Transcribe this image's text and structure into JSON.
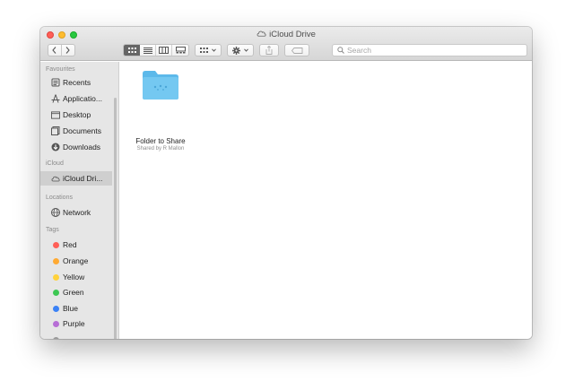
{
  "window": {
    "title": "iCloud Drive"
  },
  "toolbar": {
    "search_placeholder": "Search"
  },
  "sidebar": {
    "sections": {
      "favourites": "Favourites",
      "icloud": "iCloud",
      "locations": "Locations",
      "tags": "Tags"
    },
    "favourites": [
      {
        "label": "Recents",
        "icon": "recents-icon"
      },
      {
        "label": "Applicatio...",
        "icon": "applications-icon"
      },
      {
        "label": "Desktop",
        "icon": "desktop-icon"
      },
      {
        "label": "Documents",
        "icon": "documents-icon"
      },
      {
        "label": "Downloads",
        "icon": "downloads-icon"
      }
    ],
    "icloud": [
      {
        "label": "iCloud Dri...",
        "icon": "cloud-icon",
        "selected": true
      }
    ],
    "locations": [
      {
        "label": "Network",
        "icon": "globe-icon"
      }
    ],
    "tags": [
      {
        "label": "Red",
        "color": "#ff5f57"
      },
      {
        "label": "Orange",
        "color": "#ffaa33"
      },
      {
        "label": "Yellow",
        "color": "#ffd23c"
      },
      {
        "label": "Green",
        "color": "#3dc753"
      },
      {
        "label": "Blue",
        "color": "#3b82f6"
      },
      {
        "label": "Purple",
        "color": "#b76ed6"
      }
    ]
  },
  "content": {
    "items": [
      {
        "name": "Folder to Share",
        "subtitle": "Shared by R Mallon",
        "icon": "shared-folder-icon"
      }
    ]
  },
  "colors": {
    "folder": "#6ec4ef",
    "selection": "#cfcfcf"
  }
}
